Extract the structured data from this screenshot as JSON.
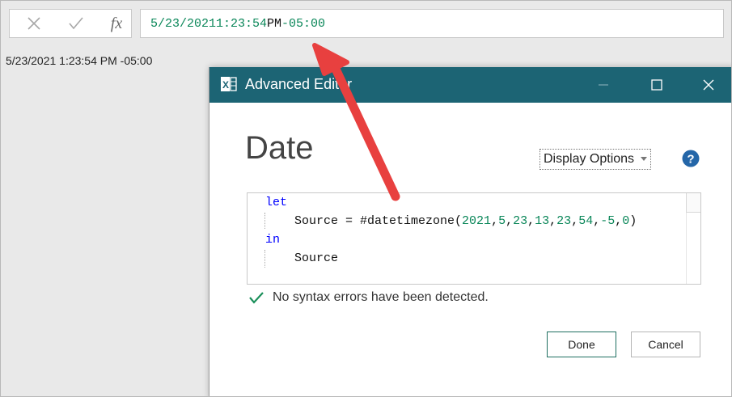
{
  "formula_bar": {
    "cancel_icon": "close-icon",
    "commit_icon": "check-icon",
    "fx_label": "fx",
    "formula_parts": [
      "5/23/2021",
      " ",
      "1:23:54",
      " PM ",
      "-05:00"
    ]
  },
  "result_value": "5/23/2021 1:23:54 PM -05:00",
  "dialog": {
    "app_icon": "excel-icon",
    "title": "Advanced Editor",
    "query_name": "Date",
    "display_options": "Display Options",
    "code": {
      "line1_kw": "let",
      "line2_pre": "    Source = #datetimezone(",
      "line2_args": [
        "2021",
        "5",
        "23",
        "13",
        "23",
        "54",
        "-5",
        "0"
      ],
      "line2_post": ")",
      "line3_kw": "in",
      "line4": "    Source"
    },
    "status_text": "No syntax errors have been detected.",
    "done_label": "Done",
    "cancel_label": "Cancel"
  },
  "colors": {
    "titlebar": "#1c6474",
    "keyword": "#0000ff",
    "number": "#098658",
    "annotation_arrow": "#e8403f",
    "success_check": "#1a8f5a",
    "help_icon": "#2466a8"
  }
}
